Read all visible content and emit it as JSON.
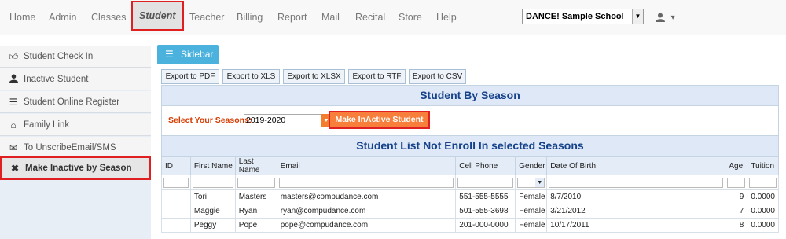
{
  "nav": {
    "items": [
      "Home",
      "Admin",
      "Classes",
      "Student",
      "Teacher",
      "Billing",
      "Report",
      "Mail",
      "Recital",
      "Store",
      "Help"
    ],
    "active": "Student",
    "school_select": "DANCE! Sample School",
    "user_caret": "▾"
  },
  "sidebar": {
    "items": [
      {
        "label": "Student Check In",
        "icon": "thumbs-up-icon"
      },
      {
        "label": "Inactive Student",
        "icon": "user-icon"
      },
      {
        "label": "Student Online Register",
        "icon": "list-icon"
      },
      {
        "label": "Family Link",
        "icon": "home-icon"
      },
      {
        "label": "To UnscribeEmail/SMS",
        "icon": "envelope-icon"
      },
      {
        "label": "Make Inactive by Season",
        "icon": "x-icon"
      }
    ],
    "active_index": 5
  },
  "main": {
    "sidebar_button": "Sidebar",
    "exports": [
      "Export to PDF",
      "Export to XLS",
      "Export to XLSX",
      "Export to RTF",
      "Export to CSV"
    ],
    "student_by_season_title": "Student By Season",
    "season_label": "Select Your Seasons:",
    "season_value": "2019-2020",
    "make_inactive_button": "Make InActive Student",
    "list_title": "Student List Not Enroll In selected Seasons",
    "columns": [
      "ID",
      "First Name",
      "Last Name",
      "Email",
      "Cell Phone",
      "Gender",
      "Date Of Birth",
      "Age",
      "Tuition"
    ],
    "rows": [
      [
        "",
        "Tori",
        "Masters",
        "masters@compudance.com",
        "551-555-5555",
        "Female",
        "8/7/2010",
        "9",
        "0.0000"
      ],
      [
        "",
        "Maggie",
        "Ryan",
        "ryan@compudance.com",
        "501-555-3698",
        "Female",
        "3/21/2012",
        "7",
        "0.0000"
      ],
      [
        "",
        "Peggy",
        "Pope",
        "pope@compudance.com",
        "201-000-0000",
        "Female",
        "10/17/2011",
        "8",
        "0.0000"
      ]
    ]
  },
  "colors": {
    "accent": "#4bb2dd",
    "header_text": "#15428b",
    "highlight_border": "#e02020",
    "action_button": "#f77e3b"
  }
}
